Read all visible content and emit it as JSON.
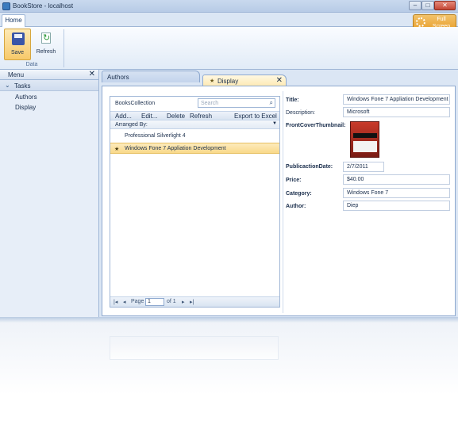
{
  "window": {
    "title": "BookStore - localhost"
  },
  "ribbon": {
    "tab_home": "Home",
    "save_label": "Save",
    "refresh_label": "Refresh",
    "group_label": "Data",
    "full_screen_line1": "Full",
    "full_screen_line2": "Screen"
  },
  "menu": {
    "title": "Menu",
    "group": "Tasks",
    "items": [
      {
        "label": "Authors"
      },
      {
        "label": "Display"
      }
    ]
  },
  "tabs": [
    {
      "label": "Authors"
    },
    {
      "label": "Display"
    }
  ],
  "books": {
    "title": "BooksCollection",
    "search_placeholder": "Search",
    "toolbar": {
      "add": "Add...",
      "edit": "Edit...",
      "delete": "Delete",
      "refresh": "Refresh",
      "export": "Export to Excel"
    },
    "arranged_by": "Arranged By:",
    "rows": [
      {
        "title": "Professional Silverlight 4",
        "selected": false
      },
      {
        "title": "Windows Fone 7 Appliation Development",
        "selected": true
      }
    ],
    "pager": {
      "page_label": "Page",
      "page_value": "1",
      "of_label": "of 1"
    }
  },
  "details": {
    "title_label": "Title:",
    "title_value": "Windows Fone 7 Appliation Development",
    "description_label": "Description:",
    "description_value": "Microsoft",
    "thumbnail_label": "FrontCoverThumbnail:",
    "pubdate_label": "PublicactionDate:",
    "pubdate_value": "2/7/2011",
    "price_label": "Price:",
    "price_value": "$40.00",
    "category_label": "Category:",
    "category_value": "Windows Fone 7",
    "author_label": "Author:",
    "author_value": "Diep"
  },
  "colors": {
    "accent_selected": "#f9d98a",
    "chrome": "#dbe6f4",
    "border": "#9fb6d6"
  }
}
